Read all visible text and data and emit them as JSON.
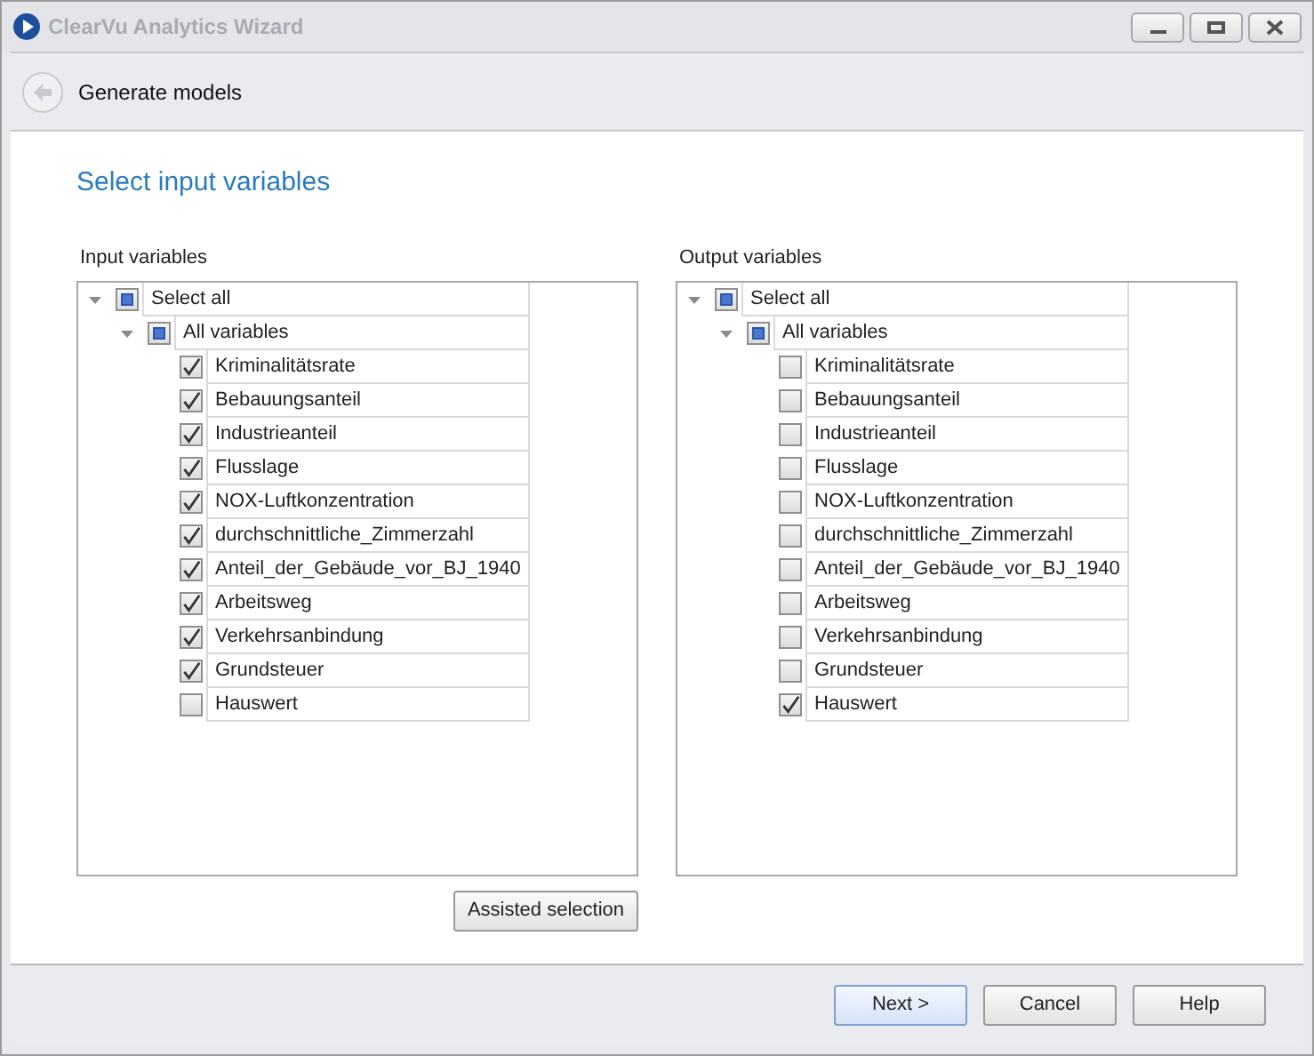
{
  "window": {
    "title": "ClearVu Analytics Wizard"
  },
  "header": {
    "title": "Generate models"
  },
  "heading": "Select input variables",
  "panels": [
    {
      "title": "Input variables",
      "tree": {
        "label": "Select all",
        "expanded": true,
        "partial": true,
        "children": [
          {
            "label": "All variables",
            "expanded": true,
            "partial": true,
            "children": [
              {
                "label": "Kriminalitätsrate",
                "checked": true
              },
              {
                "label": "Bebauungsanteil",
                "checked": true
              },
              {
                "label": "Industrieanteil",
                "checked": true
              },
              {
                "label": "Flusslage",
                "checked": true
              },
              {
                "label": "NOX-Luftkonzentration",
                "checked": true
              },
              {
                "label": "durchschnittliche_Zimmerzahl",
                "checked": true
              },
              {
                "label": "Anteil_der_Gebäude_vor_BJ_1940",
                "checked": true
              },
              {
                "label": "Arbeitsweg",
                "checked": true
              },
              {
                "label": "Verkehrsanbindung",
                "checked": true
              },
              {
                "label": "Grundsteuer",
                "checked": true
              },
              {
                "label": "Hauswert",
                "checked": false
              }
            ]
          }
        ]
      },
      "button": "Assisted selection"
    },
    {
      "title": "Output variables",
      "tree": {
        "label": "Select all",
        "expanded": true,
        "partial": true,
        "children": [
          {
            "label": "All variables",
            "expanded": true,
            "partial": true,
            "children": [
              {
                "label": "Kriminalitätsrate",
                "checked": false
              },
              {
                "label": "Bebauungsanteil",
                "checked": false
              },
              {
                "label": "Industrieanteil",
                "checked": false
              },
              {
                "label": "Flusslage",
                "checked": false
              },
              {
                "label": "NOX-Luftkonzentration",
                "checked": false
              },
              {
                "label": "durchschnittliche_Zimmerzahl",
                "checked": false
              },
              {
                "label": "Anteil_der_Gebäude_vor_BJ_1940",
                "checked": false
              },
              {
                "label": "Arbeitsweg",
                "checked": false
              },
              {
                "label": "Verkehrsanbindung",
                "checked": false
              },
              {
                "label": "Grundsteuer",
                "checked": false
              },
              {
                "label": "Hauswert",
                "checked": true
              }
            ]
          }
        ]
      }
    }
  ],
  "buttons": [
    {
      "label": "Next >",
      "selected": true
    },
    {
      "label": "Cancel",
      "selected": false
    },
    {
      "label": "Help",
      "selected": false
    }
  ]
}
